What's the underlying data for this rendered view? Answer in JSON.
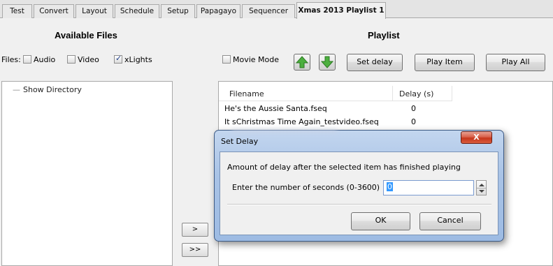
{
  "tabs": [
    "Test",
    "Convert",
    "Layout",
    "Schedule",
    "Setup",
    "Papagayo",
    "Sequencer",
    "Xmas 2013 Playlist 1"
  ],
  "active_tab_index": 7,
  "available_files": {
    "title": "Available Files",
    "files_label": "Files:",
    "filters": [
      {
        "label": "Audio",
        "checked": false
      },
      {
        "label": "Video",
        "checked": false
      },
      {
        "label": "xLights",
        "checked": true
      }
    ],
    "tree": {
      "root": "Show Directory"
    }
  },
  "transfer_buttons": [
    ">",
    ">>"
  ],
  "playlist": {
    "title": "Playlist",
    "movie_mode": {
      "label": "Movie Mode",
      "checked": false
    },
    "move_up_icon": "green-up-arrow-icon",
    "move_down_icon": "green-down-arrow-icon",
    "buttons": {
      "set_delay": "Set delay",
      "play_item": "Play Item",
      "play_all": "Play All"
    },
    "columns": [
      "Filename",
      "Delay (s)"
    ],
    "rows": [
      {
        "filename": "He's the Aussie Santa.fseq",
        "delay": "0"
      },
      {
        "filename": "It sChristmas Time Again_testvideo.fseq",
        "delay": "0"
      }
    ]
  },
  "dialog": {
    "title": "Set Delay",
    "close_label": "X",
    "message": "Amount of delay after the selected item has finished playing",
    "prompt": "Enter the number of seconds (0-3600)",
    "value": "0",
    "ok": "OK",
    "cancel": "Cancel"
  },
  "colors": {
    "accent_green": "#4caf3f",
    "dialog_frame": "#a9c3e6",
    "close_red": "#c6361c",
    "selection": "#3399ff"
  }
}
